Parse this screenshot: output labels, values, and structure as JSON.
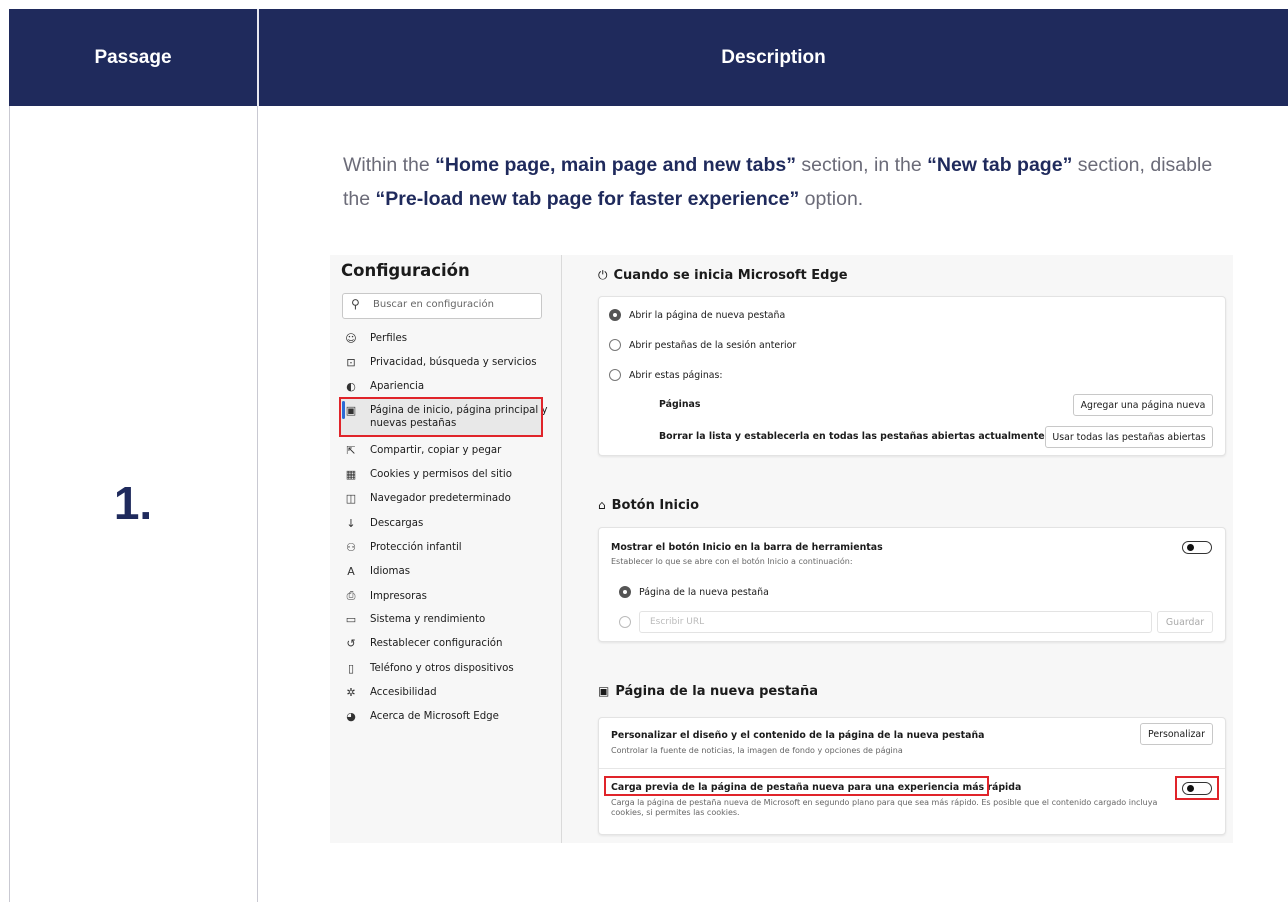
{
  "header": {
    "passage_label": "Passage",
    "description_label": "Description"
  },
  "step": {
    "number": "1."
  },
  "instruction": {
    "part1": "Within the ",
    "bold1": "“Home page, main page and new tabs”",
    "part2": " section, in the ",
    "bold2": "“New tab page”",
    "part3": " section, disable the ",
    "bold3": "“Pre-load new tab page for faster experience”",
    "part4": " option."
  },
  "settings": {
    "sidebar": {
      "title": "Configuración",
      "search_placeholder": "Buscar en configuración",
      "items": [
        {
          "icon": "profile-icon",
          "glyph": "☺",
          "label": "Perfiles"
        },
        {
          "icon": "lock-icon",
          "glyph": "⊡",
          "label": "Privacidad, búsqueda y servicios"
        },
        {
          "icon": "appearance-icon",
          "glyph": "◐",
          "label": "Apariencia"
        },
        {
          "icon": "homepage-icon",
          "glyph": "▣",
          "label": "Página de inicio, página principal y",
          "label2": "nuevas pestañas"
        },
        {
          "icon": "share-icon",
          "glyph": "⇱",
          "label": "Compartir, copiar y pegar"
        },
        {
          "icon": "cookies-icon",
          "glyph": "▦",
          "label": "Cookies y permisos del sitio"
        },
        {
          "icon": "browser-icon",
          "glyph": "◫",
          "label": "Navegador predeterminado"
        },
        {
          "icon": "download-icon",
          "glyph": "↓",
          "label": "Descargas"
        },
        {
          "icon": "family-icon",
          "glyph": "⚇",
          "label": "Protección infantil"
        },
        {
          "icon": "language-icon",
          "glyph": "A",
          "label": "Idiomas"
        },
        {
          "icon": "printer-icon",
          "glyph": "⎙",
          "label": "Impresoras"
        },
        {
          "icon": "system-icon",
          "glyph": "▭",
          "label": "Sistema y rendimiento"
        },
        {
          "icon": "reset-icon",
          "glyph": "↺",
          "label": "Restablecer configuración"
        },
        {
          "icon": "phone-icon",
          "glyph": "▯",
          "label": "Teléfono y otros dispositivos"
        },
        {
          "icon": "accessibility-icon",
          "glyph": "✲",
          "label": "Accesibilidad"
        },
        {
          "icon": "edge-icon",
          "glyph": "◕",
          "label": "Acerca de Microsoft Edge"
        }
      ]
    },
    "startup": {
      "title": "Cuando se inicia Microsoft Edge",
      "icon_glyph": "⏻",
      "options": [
        "Abrir la página de nueva pestaña",
        "Abrir pestañas de la sesión anterior",
        "Abrir estas páginas:"
      ],
      "pages_label": "Páginas",
      "add_page_button": "Agregar una página nueva",
      "clear_label": "Borrar la lista y establecerla en todas las pestañas abiertas actualmente",
      "use_all_button": "Usar todas las pestañas abiertas"
    },
    "home_button": {
      "title": "Botón Inicio",
      "icon_glyph": "⌂",
      "show_label": "Mostrar el botón Inicio en la barra de herramientas",
      "show_sub": "Establecer lo que se abre con el botón Inicio a continuación:",
      "option_newtab": "Página de la nueva pestaña",
      "url_placeholder": "Escribir URL",
      "save_button": "Guardar"
    },
    "new_tab": {
      "title": "Página de la nueva pestaña",
      "icon_glyph": "▣",
      "customize_label": "Personalizar el diseño y el contenido de la página de la nueva pestaña",
      "customize_sub": "Controlar la fuente de noticias, la imagen de fondo y opciones de página",
      "customize_button": "Personalizar",
      "preload_label": "Carga previa de la página de pestaña nueva para una experiencia más rápida",
      "preload_sub1": "Carga la página de pestaña nueva de Microsoft en segundo plano para que sea más rápido. Es posible que el contenido cargado incluya",
      "preload_sub2": "cookies, si permites las cookies."
    }
  },
  "colors": {
    "header_bg": "#1f2a5c",
    "highlight": "#e0242a",
    "accent": "#2b6ad4"
  }
}
